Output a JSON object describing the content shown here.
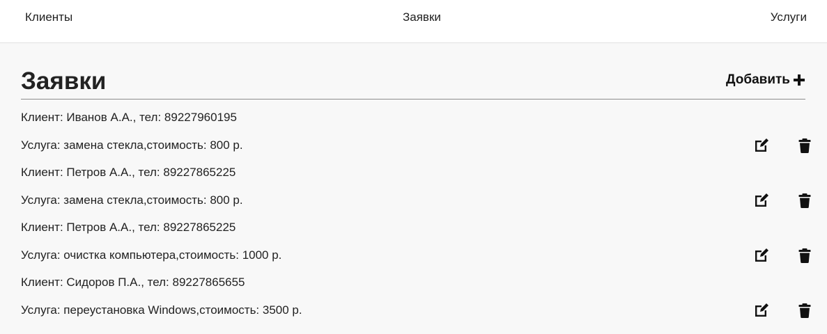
{
  "nav": {
    "clients": "Клиенты",
    "orders": "Заявки",
    "services": "Услуги"
  },
  "page": {
    "title": "Заявки",
    "add_label": "Добавить"
  },
  "orders": [
    {
      "client": "Клиент: Иванов А.А., тел: 89227960195",
      "service": "Услуга: замена стекла,стоимость: 800 р."
    },
    {
      "client": "Клиент: Петров А.А., тел: 89227865225",
      "service": "Услуга: замена стекла,стоимость: 800 р."
    },
    {
      "client": "Клиент: Петров А.А., тел: 89227865225",
      "service": "Услуга: очистка компьютера,стоимость: 1000 р."
    },
    {
      "client": "Клиент: Сидоров П.А., тел: 89227865655",
      "service": "Услуга: переустановка Windows,стоимость: 3500 р."
    }
  ],
  "icons": {
    "add": "plus-icon",
    "edit": "edit-icon",
    "delete": "trash-icon"
  },
  "colors": {
    "background": "#f8f8f8",
    "topbar": "#ffffff",
    "text": "#1f1f1f"
  }
}
